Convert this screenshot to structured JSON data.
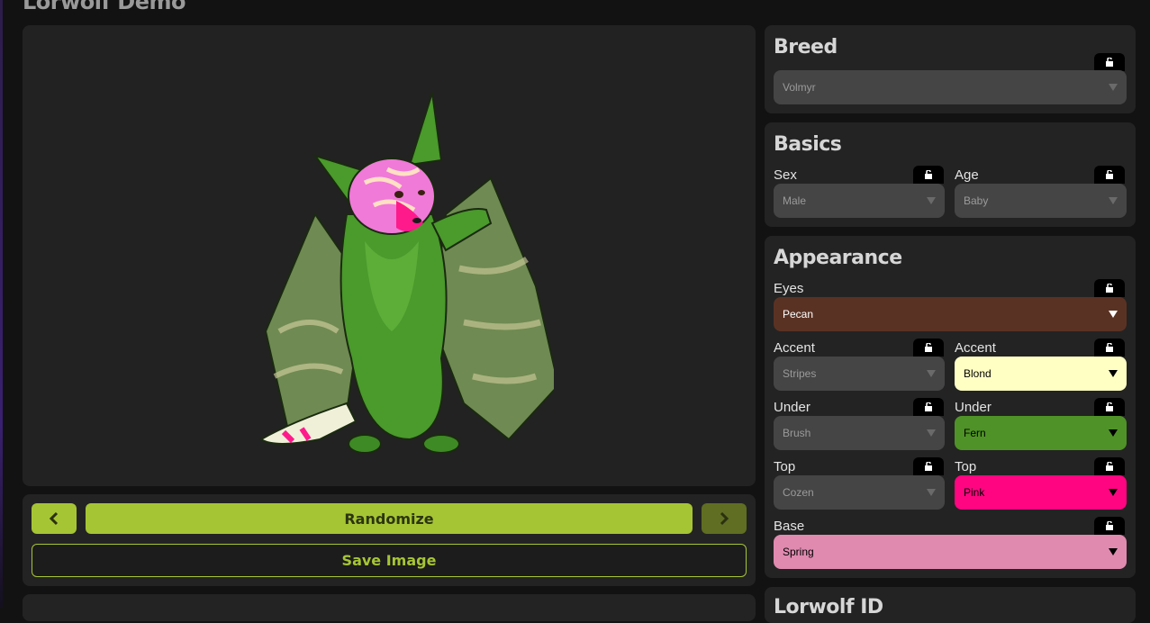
{
  "page": {
    "title": "Lorwolf Demo"
  },
  "controls": {
    "prev_label": "‹",
    "next_label": "›",
    "randomize_label": "Randomize",
    "save_label": "Save Image"
  },
  "breed": {
    "title": "Breed",
    "value": "Volmyr"
  },
  "basics": {
    "title": "Basics",
    "sex": {
      "label": "Sex",
      "value": "Male"
    },
    "age": {
      "label": "Age",
      "value": "Baby"
    }
  },
  "appearance": {
    "title": "Appearance",
    "eyes": {
      "label": "Eyes",
      "value": "Pecan",
      "color": "#5a3223",
      "text_color": "#ffffff"
    },
    "accent_pattern": {
      "label": "Accent",
      "value": "Stripes"
    },
    "accent_color": {
      "label": "Accent",
      "value": "Blond",
      "color": "#ffffc4",
      "text_color": "#000000"
    },
    "under_pattern": {
      "label": "Under",
      "value": "Brush"
    },
    "under_color": {
      "label": "Under",
      "value": "Fern",
      "color": "#4f9227",
      "text_color": "#000000"
    },
    "top_pattern": {
      "label": "Top",
      "value": "Cozen"
    },
    "top_color": {
      "label": "Top",
      "value": "Pink",
      "color": "#ff0581",
      "text_color": "#000000"
    },
    "base": {
      "label": "Base",
      "value": "Spring",
      "color": "#e08ab0",
      "text_color": "#000000"
    }
  },
  "lineart": {
    "title": "Lorwolf ID"
  },
  "icons": {
    "lock": "unlock-icon",
    "prev": "chevron-left-icon",
    "next": "chevron-right-icon",
    "dropdown": "caret-down-icon"
  },
  "colors": {
    "accent": "#a6c534",
    "panel": "#232323",
    "background": "#121212",
    "dropdown": "#454545"
  }
}
